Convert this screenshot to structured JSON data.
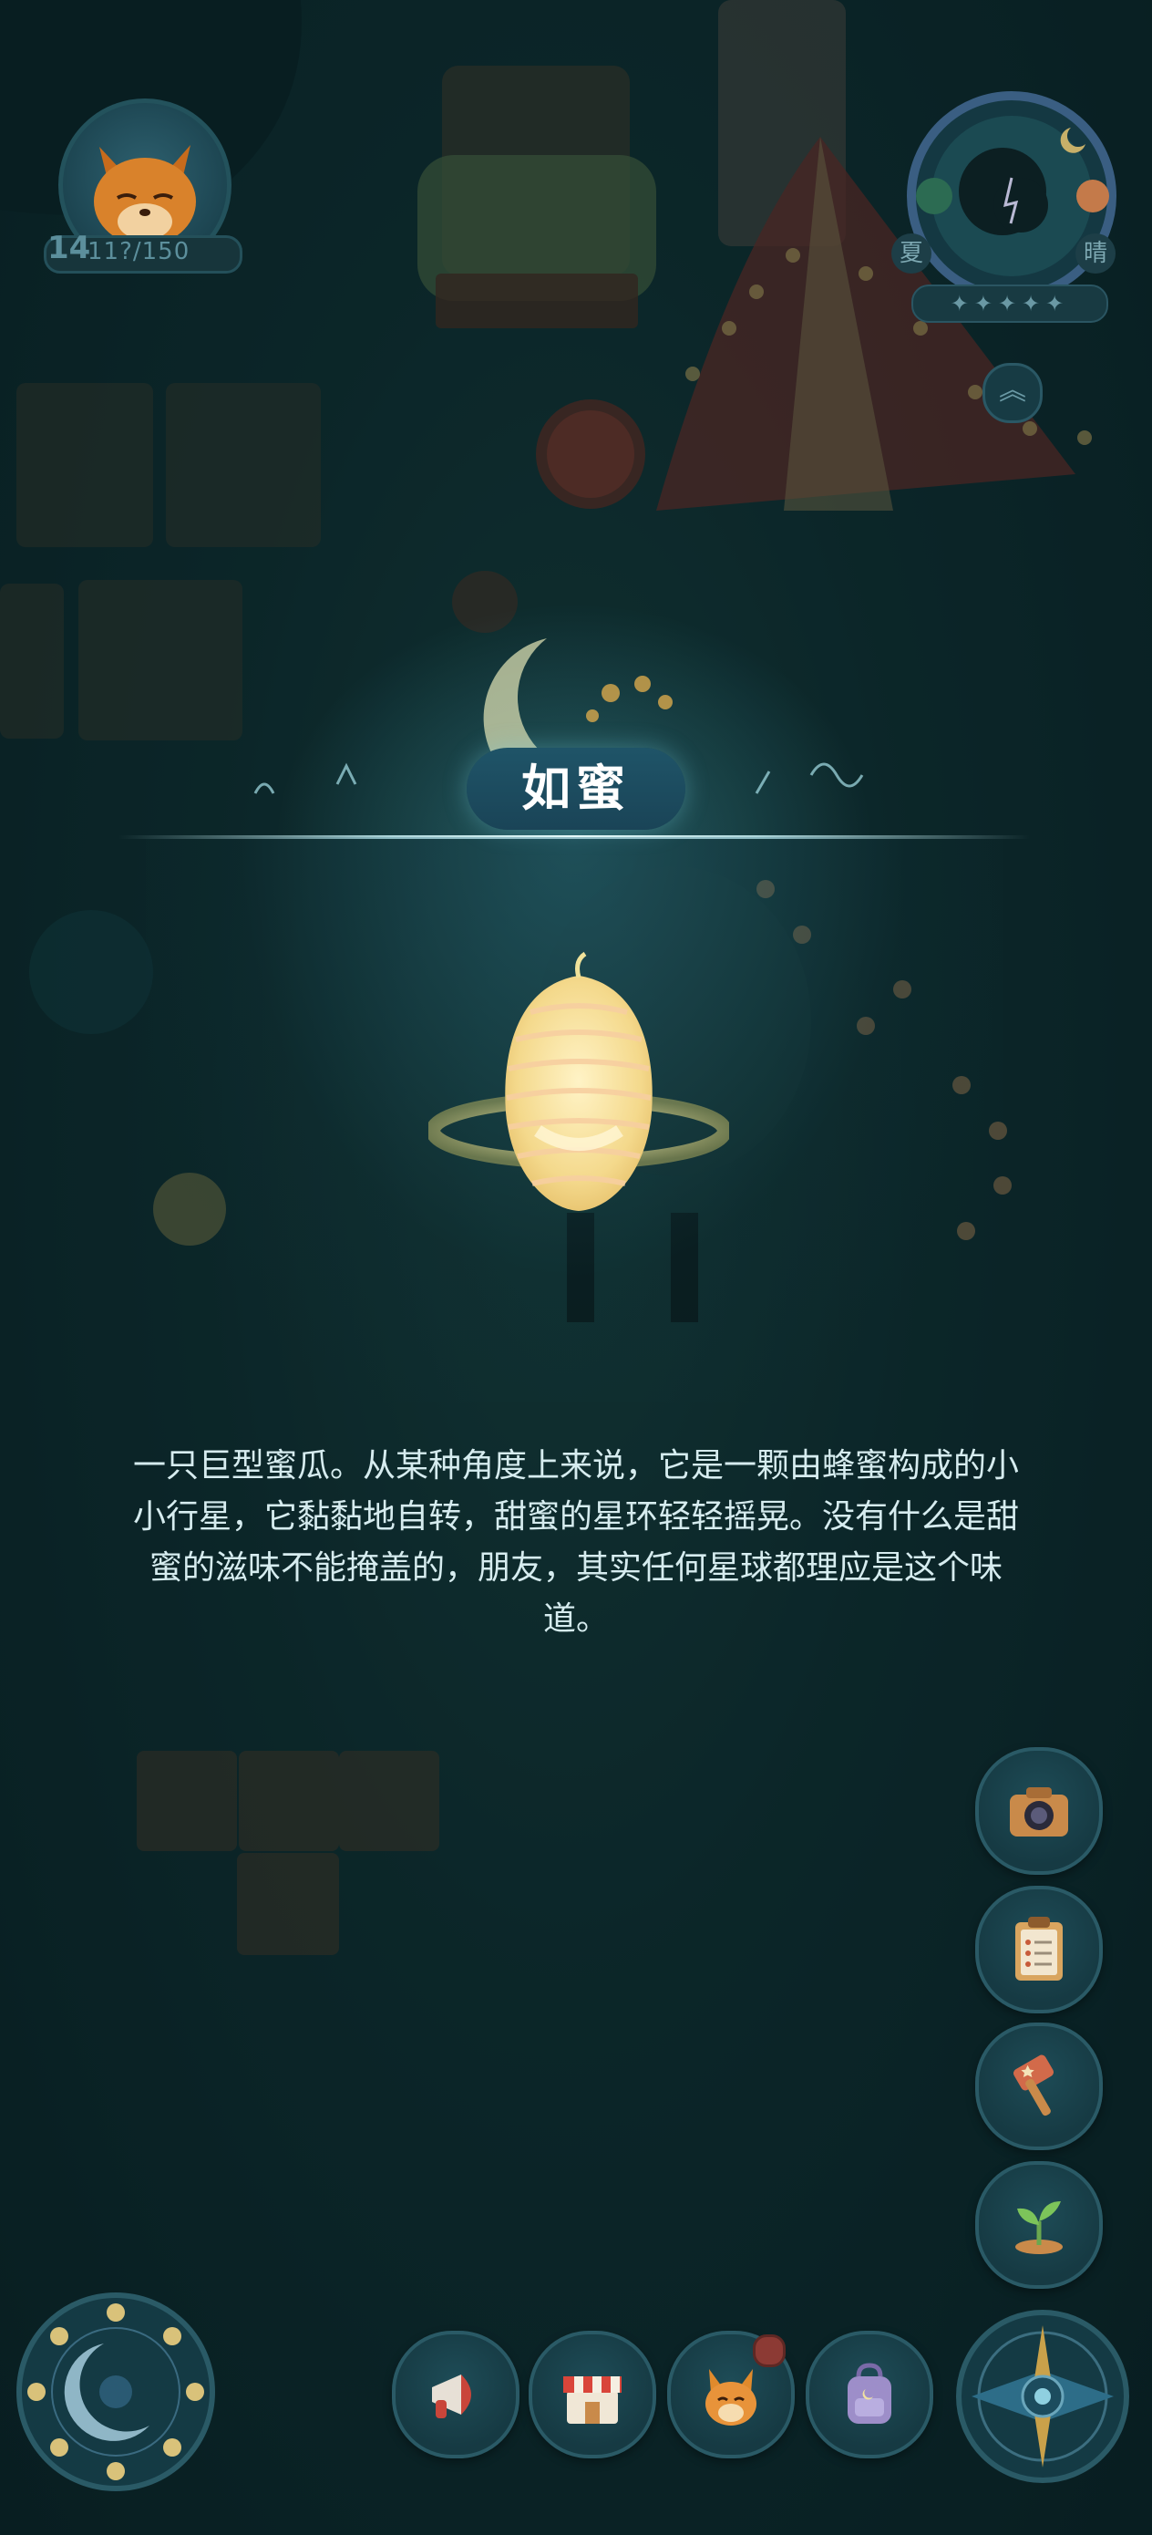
{
  "player": {
    "level": "14",
    "exp": "11?/150"
  },
  "season": {
    "season_label": "夏",
    "weather_label": "晴",
    "stars": "✦✦✦✦✦"
  },
  "item": {
    "title": "如蜜",
    "description": "一只巨型蜜瓜。从某种角度上来说，它是一颗由蜂蜜构成的小小行星，它黏黏地自转，甜蜜的星环轻轻摇晃。没有什么是甜蜜的滋味不能掩盖的，朋友，其实任何星球都理应是这个味道。"
  },
  "side_buttons": [
    {
      "icon": "camera-icon"
    },
    {
      "icon": "clipboard-icon"
    },
    {
      "icon": "hammer-icon"
    },
    {
      "icon": "sprout-icon"
    }
  ],
  "dock": [
    {
      "icon": "megaphone-icon"
    },
    {
      "icon": "shop-icon"
    },
    {
      "icon": "fox-icon",
      "has_notification": true
    },
    {
      "icon": "backpack-icon"
    }
  ],
  "colors": {
    "background": "#0e2a2d",
    "banner": "#1f5468",
    "honey": "#f5e2a0",
    "text": "#d6ecef"
  }
}
